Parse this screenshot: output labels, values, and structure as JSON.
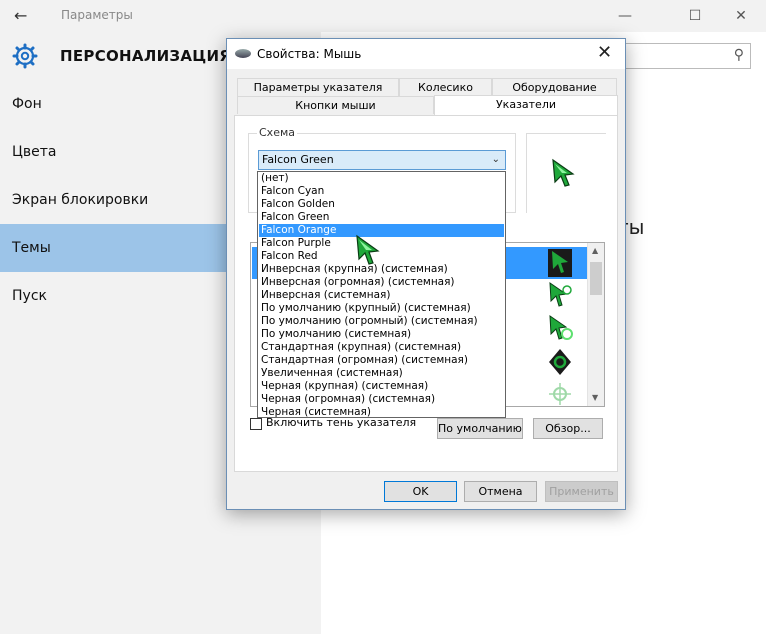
{
  "settings": {
    "window_title": "Параметры",
    "back_glyph": "←",
    "minimize_glyph": "—",
    "maximize_glyph": "☐",
    "close_glyph": "✕",
    "heading": "ПЕРСОНАЛИЗАЦИЯ",
    "nav": [
      {
        "label": "Фон"
      },
      {
        "label": "Цвета"
      },
      {
        "label": "Экран блокировки"
      },
      {
        "label": "Темы"
      },
      {
        "label": "Пуск"
      }
    ],
    "search_icon_glyph": "⚲",
    "themes_partial_text": "ты"
  },
  "dialog": {
    "title": "Свойства: Мышь",
    "close_glyph": "✕",
    "tabs": [
      {
        "label": "Параметры указателя"
      },
      {
        "label": "Колесико"
      },
      {
        "label": "Оборудование"
      },
      {
        "label": "Кнопки мыши"
      },
      {
        "label": "Указатели"
      }
    ],
    "scheme_label": "Схема",
    "scheme_value": "Falcon Green",
    "combo_arrow": "⌄",
    "shadow_checkbox_label": "Включить тень указателя",
    "default_button": "По умолчанию",
    "browse_button": "Обзор...",
    "ok_button": "OK",
    "cancel_button": "Отмена",
    "apply_button": "Применить",
    "scroll_up": "▲",
    "scroll_down": "▼"
  },
  "dropdown": {
    "items": [
      "(нет)",
      "Falcon Cyan",
      "Falcon Golden",
      "Falcon Green",
      "Falcon Orange",
      "Falcon Purple",
      "Falcon Red",
      "Инверсная (крупная) (системная)",
      "Инверсная (огромная) (системная)",
      "Инверсная (системная)",
      "По умолчанию (крупный) (системная)",
      "По умолчанию (огромный) (системная)",
      "По умолчанию (системная)",
      "Стандартная (крупная) (системная)",
      "Стандартная (огромная) (системная)",
      "Увеличенная (системная)",
      "Черная (крупная) (системная)",
      "Черная (огромная) (системная)",
      "Черная (системная)"
    ],
    "highlighted": "Falcon Orange"
  },
  "colors": {
    "accent": "#9cc4e8",
    "selection": "#3399ff",
    "cursor_green": "#1fa83a"
  }
}
